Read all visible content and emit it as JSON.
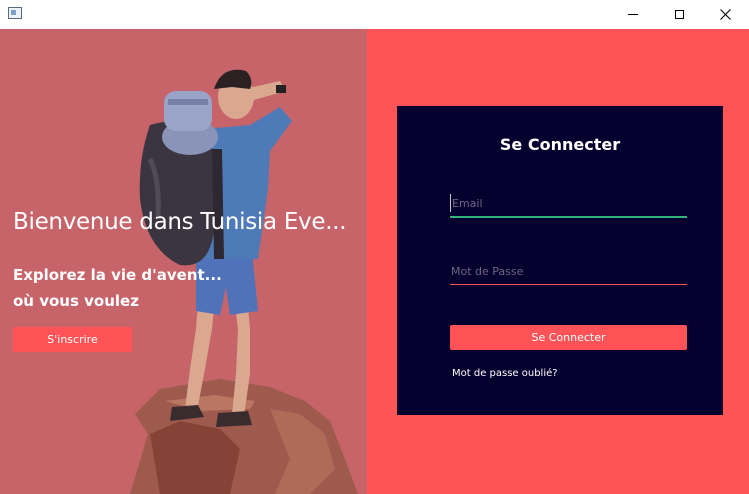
{
  "window": {
    "app_icon": "window-app-icon",
    "close_glyph": "✕"
  },
  "left": {
    "welcome_title": "Bienvenue dans Tunisia Eve...",
    "subtitle_line1": "Explorez la vie d'avent...",
    "subtitle_line2": "où vous voulez",
    "signup_label": "S'inscrire"
  },
  "login": {
    "title": "Se Connecter",
    "email_placeholder": "Email",
    "password_placeholder": "Mot de Passe",
    "submit_label": "Se Connecter",
    "forgot_label": "Mot de passe oublié?"
  },
  "colors": {
    "left_bg": "#c7646a",
    "right_bg": "#ff5358",
    "card_bg": "#06002e",
    "accent": "#ff5358",
    "email_underline": "#33b27a"
  }
}
